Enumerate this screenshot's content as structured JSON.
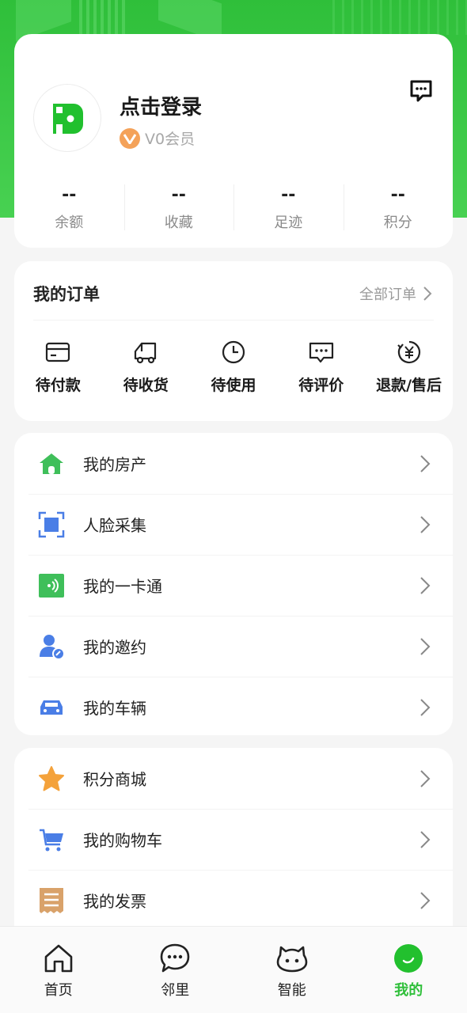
{
  "profile": {
    "login_label": "点击登录",
    "vip_badge": "V",
    "vip_label": "V0会员",
    "stats": [
      {
        "value": "--",
        "label": "余额"
      },
      {
        "value": "--",
        "label": "收藏"
      },
      {
        "value": "--",
        "label": "足迹"
      },
      {
        "value": "--",
        "label": "积分"
      }
    ]
  },
  "orders": {
    "title": "我的订单",
    "all_label": "全部订单",
    "items": [
      {
        "label": "待付款",
        "icon": "card-icon"
      },
      {
        "label": "待收货",
        "icon": "truck-icon"
      },
      {
        "label": "待使用",
        "icon": "clock-icon"
      },
      {
        "label": "待评价",
        "icon": "comment-icon"
      },
      {
        "label": "退款/售后",
        "icon": "refund-yen-icon"
      }
    ]
  },
  "menu1": [
    {
      "label": "我的房产",
      "icon": "house-icon"
    },
    {
      "label": "人脸采集",
      "icon": "face-scan-icon"
    },
    {
      "label": "我的一卡通",
      "icon": "nfc-card-icon"
    },
    {
      "label": "我的邀约",
      "icon": "invite-user-icon"
    },
    {
      "label": "我的车辆",
      "icon": "car-icon"
    }
  ],
  "menu2": [
    {
      "label": "积分商城",
      "icon": "star-icon"
    },
    {
      "label": "我的购物车",
      "icon": "cart-icon"
    },
    {
      "label": "我的发票",
      "icon": "invoice-icon"
    }
  ],
  "nav": [
    {
      "label": "首页",
      "icon": "home-icon"
    },
    {
      "label": "邻里",
      "icon": "chat-bubble-icon"
    },
    {
      "label": "智能",
      "icon": "robot-icon"
    },
    {
      "label": "我的",
      "icon": "profile-smile-icon",
      "active": true
    }
  ],
  "colors": {
    "brand_green": "#2fbf3a",
    "vip_orange": "#f4a259",
    "icon_blue": "#4a7ee6",
    "icon_green": "#3fbf5a"
  }
}
